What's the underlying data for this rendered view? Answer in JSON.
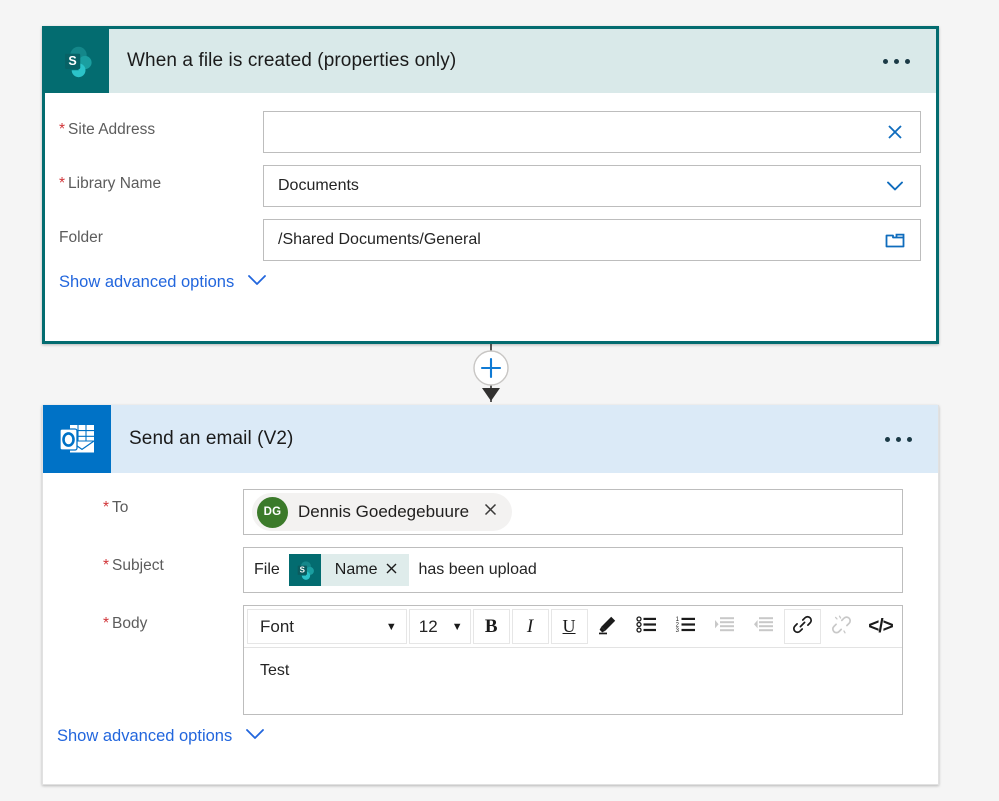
{
  "page": {
    "background": "#f5f5f5"
  },
  "colors": {
    "sharepoint_teal": "#036c70",
    "sharepoint_header": "#d9e9e9",
    "outlook_blue": "#0072c6",
    "outlook_header": "#dbeaf7",
    "link_blue": "#2266dd",
    "icon_blue": "#0f6cbd",
    "required_red": "#d13438",
    "avatar_green": "#3b7a2a",
    "token_bg": "#dfeceb"
  },
  "trigger_card": {
    "icon": "sharepoint-icon",
    "title": "When a file is created (properties only)",
    "menu": "more-options-icon",
    "fields": [
      {
        "label": "Site Address",
        "required": true,
        "value": "",
        "icon": "close-icon",
        "icon_name": "clear-site-address-icon"
      },
      {
        "label": "Library Name",
        "required": true,
        "value": "Documents",
        "icon": "chevron-down-icon",
        "icon_name": "library-name-dropdown-icon"
      },
      {
        "label": "Folder",
        "required": false,
        "value": "/Shared Documents/General",
        "icon": "folder-icon",
        "icon_name": "folder-picker-icon"
      }
    ],
    "advanced_label": "Show advanced options",
    "advanced_icon": "chevron-down-icon"
  },
  "connector": {
    "add_label": "+",
    "icon": "add-step-icon",
    "arrow_icon": "arrow-down-icon"
  },
  "email_card": {
    "icon": "outlook-icon",
    "title": "Send an email (V2)",
    "menu": "more-options-icon",
    "to": {
      "label": "To",
      "required": true,
      "recipient": {
        "initials": "DG",
        "name": "Dennis Goedegebuure",
        "remove_icon": "close-icon"
      }
    },
    "subject": {
      "label": "Subject",
      "required": true,
      "prefix_text": "File",
      "token": {
        "icon": "sharepoint-icon",
        "label": "Name",
        "remove_icon": "close-icon"
      },
      "suffix_text": "has been upload"
    },
    "body": {
      "label": "Body",
      "required": true,
      "content": "Test",
      "toolbar": {
        "font_name": "Font",
        "font_size": "12",
        "buttons": [
          {
            "name": "bold-button",
            "glyph": "B",
            "enabled": true
          },
          {
            "name": "italic-button",
            "glyph": "I",
            "enabled": true
          },
          {
            "name": "underline-button",
            "glyph": "U",
            "enabled": true
          },
          {
            "name": "highlight-button",
            "glyph": "highlighter-icon",
            "enabled": true
          },
          {
            "name": "bulleted-list-button",
            "glyph": "bulleted-list-icon",
            "enabled": true
          },
          {
            "name": "numbered-list-button",
            "glyph": "numbered-list-icon",
            "enabled": true
          },
          {
            "name": "indent-button",
            "glyph": "indent-icon",
            "enabled": false
          },
          {
            "name": "outdent-button",
            "glyph": "outdent-icon",
            "enabled": false
          },
          {
            "name": "link-button",
            "glyph": "link-icon",
            "enabled": true
          },
          {
            "name": "unlink-button",
            "glyph": "unlink-icon",
            "enabled": false
          },
          {
            "name": "code-view-button",
            "glyph": "</>",
            "enabled": true
          }
        ]
      }
    },
    "advanced_label": "Show advanced options",
    "advanced_icon": "chevron-down-icon"
  }
}
